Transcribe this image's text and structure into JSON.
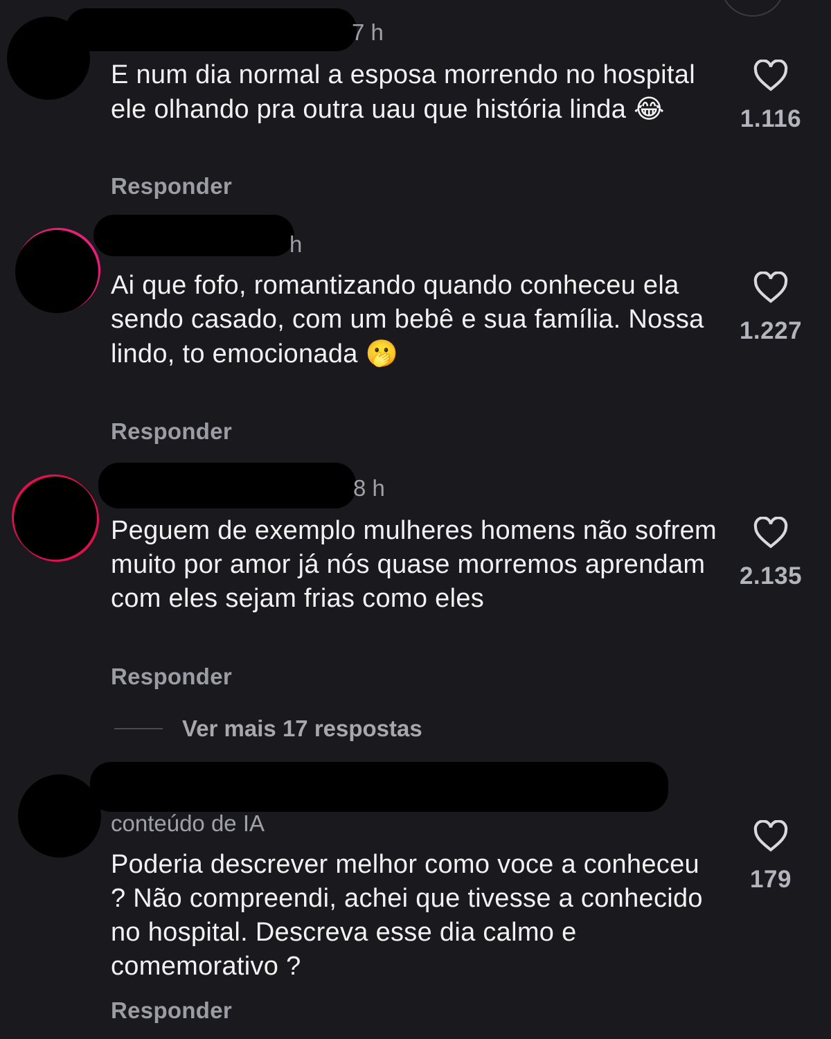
{
  "comments": [
    {
      "time": "7 h",
      "text": "E num dia normal a esposa morrendo no hospital ele olhando pra outra uau que história linda",
      "emoji": "😂",
      "likes": "1.116",
      "reply_label": "Responder"
    },
    {
      "time": "h",
      "text": "Ai que fofo, romantizando quando conheceu ela sendo casado, com um bebê e sua família. Nossa lindo, to emocionada",
      "emoji": "🫢",
      "likes": "1.227",
      "reply_label": "Responder"
    },
    {
      "time": "8 h",
      "text": "Peguem  de exemplo mulheres homens não sofrem muito por amor já nós quase morremos aprendam com eles sejam frias como eles",
      "likes": "2.135",
      "reply_label": "Responder",
      "more_replies": "Ver mais 17 respostas"
    },
    {
      "subtitle": "conteúdo de IA",
      "text": "Poderia descrever melhor como voce a conheceu ? Não compreendi, achei que tivesse a conhecido no hospital. Descreva esse dia calmo e comemorativo ?",
      "likes": "179",
      "reply_label": "Responder"
    }
  ]
}
